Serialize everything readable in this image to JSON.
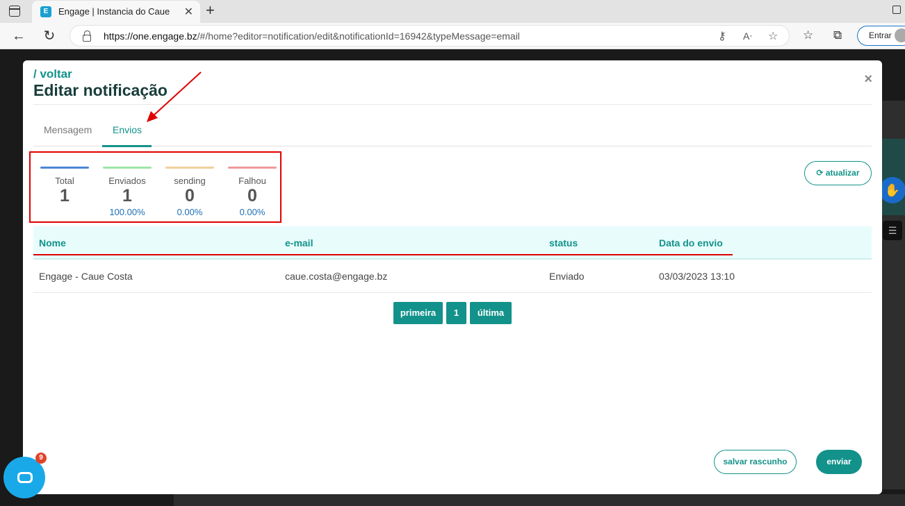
{
  "browser": {
    "tab_title": "Engage | Instancia do Caue",
    "favicon_letter": "E",
    "url_domain": "https://one.engage.bz",
    "url_path": "/#/home?editor=notification/edit&notificationId=16942&typeMessage=email",
    "signin_label": "Entrar"
  },
  "modal": {
    "back_label": "/ voltar",
    "title": "Editar notificação",
    "close_label": "×",
    "tabs": [
      {
        "label": "Mensagem"
      },
      {
        "label": "Envios"
      }
    ],
    "stats": [
      {
        "label": "Total",
        "value": "1",
        "pct": "",
        "color": "#4a86d4"
      },
      {
        "label": "Enviados",
        "value": "1",
        "pct": "100.00%",
        "color": "#9ce6a6"
      },
      {
        "label": "sending",
        "value": "0",
        "pct": "0.00%",
        "color": "#f0d09a"
      },
      {
        "label": "Falhou",
        "value": "0",
        "pct": "0.00%",
        "color": "#ee9a9a"
      }
    ],
    "refresh_label": "⟳ atualizar",
    "table": {
      "headers": [
        "Nome",
        "e-mail",
        "status",
        "Data do envio"
      ],
      "rows": [
        [
          "Engage - Caue Costa",
          "caue.costa@engage.bz",
          "Enviado",
          "03/03/2023 13:10"
        ]
      ]
    },
    "pagination": {
      "first": "primeira",
      "page": "1",
      "last": "última"
    },
    "save_draft_label": "salvar rascunho",
    "send_label": "enviar"
  },
  "chat": {
    "badge_count": "9"
  },
  "colors": {
    "accent": "#12928a",
    "annotation": "#e00000"
  }
}
